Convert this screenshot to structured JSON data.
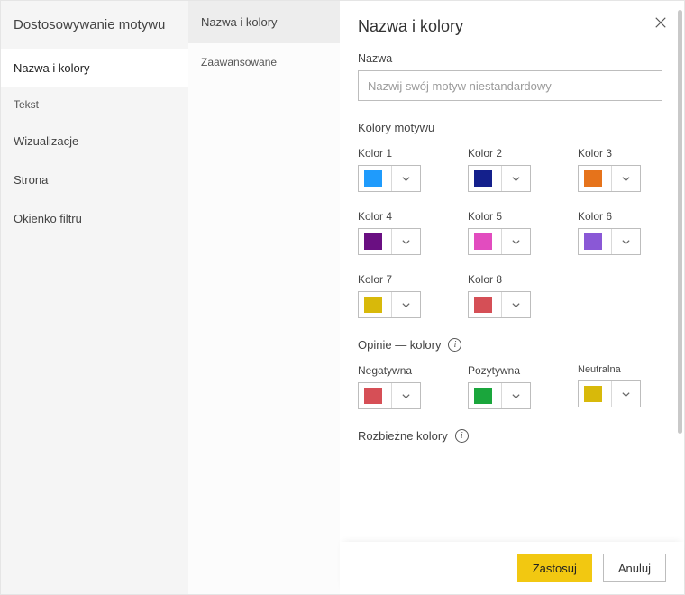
{
  "sidebar1": {
    "title": "Dostosowywanie motywu",
    "items": [
      {
        "label": "Nazwa i kolory",
        "active": true
      },
      {
        "label": "Tekst"
      },
      {
        "label": "Wizualizacje"
      },
      {
        "label": "Strona"
      },
      {
        "label": "Okienko filtru"
      }
    ]
  },
  "sidebar2": {
    "items": [
      {
        "label": "Nazwa i kolory",
        "active": true
      },
      {
        "label": "Zaawansowane"
      }
    ]
  },
  "panel": {
    "title": "Nazwa i kolory",
    "name_label": "Nazwa",
    "name_placeholder": "Nazwij swój motyw niestandardowy",
    "theme_colors_label": "Kolory motywu",
    "colors": [
      {
        "label": "Kolor 1",
        "hex": "#1F9BFC"
      },
      {
        "label": "Kolor 2",
        "hex": "#14208C"
      },
      {
        "label": "Kolor 3",
        "hex": "#E6731B"
      },
      {
        "label": "Kolor 4",
        "hex": "#6A0F82"
      },
      {
        "label": "Kolor 5",
        "hex": "#E24CBF"
      },
      {
        "label": "Kolor 6",
        "hex": "#8A58D6"
      },
      {
        "label": "Kolor 7",
        "hex": "#D8B90A"
      },
      {
        "label": "Kolor 8",
        "hex": "#D54F56"
      }
    ],
    "feedback_section": "Opinie — kolory",
    "feedback": [
      {
        "label": "Negatywna",
        "hex": "#D64F56"
      },
      {
        "label": "Pozytywna",
        "hex": "#1AA63C"
      },
      {
        "label": "Neutralna",
        "hex": "#D8B90A"
      }
    ],
    "divergent_section": "Rozbieżne kolory"
  },
  "footer": {
    "apply": "Zastosuj",
    "cancel": "Anuluj"
  }
}
